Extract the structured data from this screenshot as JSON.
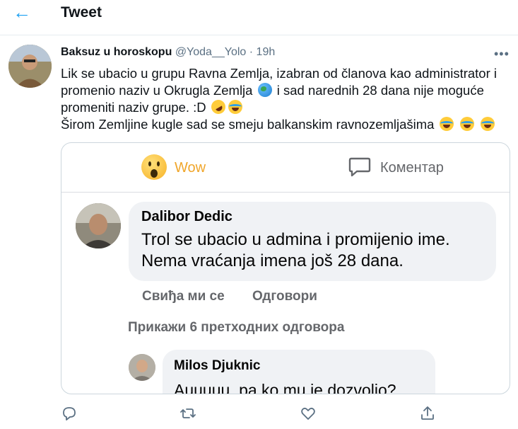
{
  "header": {
    "back_icon": "arrow-left-icon",
    "title": "Tweet",
    "accent": "#1da1f2"
  },
  "tweet": {
    "author_name": "Baksuz u horoskopu",
    "handle": "@Yoda__Yolo",
    "separator": "·",
    "time": "19h",
    "more_icon": "more-horizontal-icon",
    "text_lines": [
      "Lik se ubacio u grupu Ravna Zemlja, izabran od članova kao administrator i",
      "promenio naziv u Okrugla Zemlja",
      "i sad narednih 28 dana nije moguće",
      "promeniti naziv grupe. :D",
      "Širom Zemljine kugle sad se smeju balkanskim ravnozemljašima"
    ]
  },
  "embedded": {
    "reaction_label": "Wow",
    "comment_label": "Коментар",
    "comment1": {
      "name": "Dalibor Dedic",
      "line1": "Trol se ubacio u admina i promijenio ime.",
      "line2": "Nema vraćanja imena još 28 dana."
    },
    "like_label": "Свиђа ми се",
    "reply_label": "Одговори",
    "prev_replies": "Прикажи 6 претходних одговора",
    "comment2": {
      "name": "Milos Djuknic",
      "text": "Auuuuu, pa,ko mu je dozvolio?"
    }
  },
  "actions": {
    "icons": [
      "reply-icon",
      "retweet-icon",
      "like-icon",
      "share-icon"
    ],
    "color": "#5b7083"
  }
}
